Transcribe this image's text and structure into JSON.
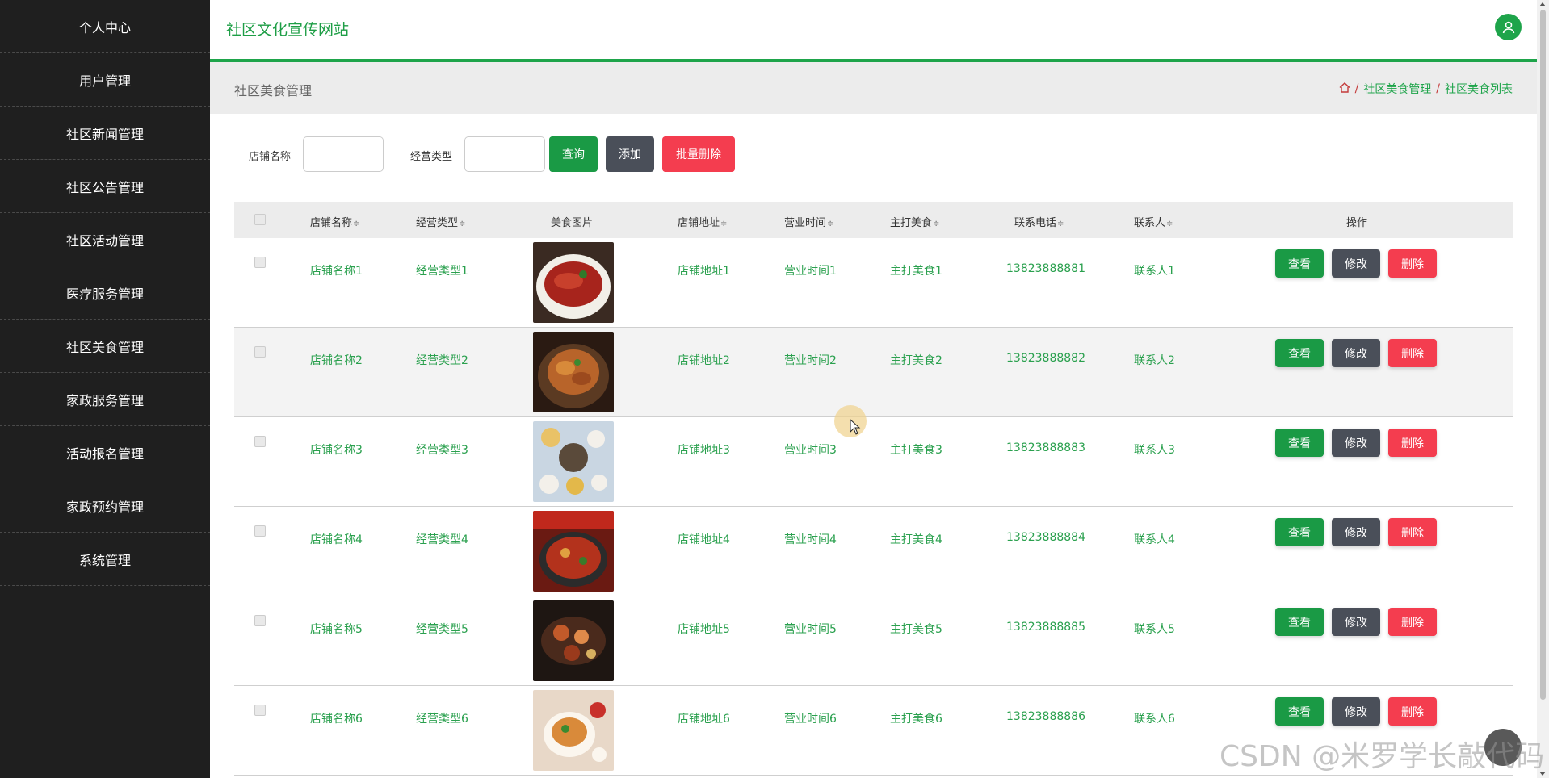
{
  "sidebar": {
    "items": [
      {
        "label": "个人中心"
      },
      {
        "label": "用户管理"
      },
      {
        "label": "社区新闻管理"
      },
      {
        "label": "社区公告管理"
      },
      {
        "label": "社区活动管理"
      },
      {
        "label": "医疗服务管理"
      },
      {
        "label": "社区美食管理"
      },
      {
        "label": "家政服务管理"
      },
      {
        "label": "活动报名管理"
      },
      {
        "label": "家政预约管理"
      },
      {
        "label": "系统管理"
      }
    ]
  },
  "header": {
    "title": "社区文化宣传网站",
    "avatar_icon": "user-icon"
  },
  "breadcrumb": {
    "page_title": "社区美食管理",
    "home_icon": "home-icon",
    "level1": "社区美食管理",
    "level2": "社区美食列表",
    "separator": "/"
  },
  "search": {
    "shop_name_label": "店铺名称",
    "shop_name_value": "",
    "business_type_label": "经营类型",
    "business_type_value": "",
    "query_label": "查询",
    "add_label": "添加",
    "batch_delete_label": "批量删除"
  },
  "table": {
    "columns": [
      "店铺名称",
      "经营类型",
      "美食图片",
      "店铺地址",
      "营业时间",
      "主打美食",
      "联系电话",
      "联系人",
      "操作"
    ],
    "sort_icon": "≑",
    "actions": {
      "view": "查看",
      "edit": "修改",
      "delete": "删除"
    },
    "rows": [
      {
        "shop": "店铺名称1",
        "type": "经营类型1",
        "address": "店铺地址1",
        "hours": "营业时间1",
        "signature": "主打美食1",
        "phone": "13823888881",
        "contact": "联系人1"
      },
      {
        "shop": "店铺名称2",
        "type": "经营类型2",
        "address": "店铺地址2",
        "hours": "营业时间2",
        "signature": "主打美食2",
        "phone": "13823888882",
        "contact": "联系人2"
      },
      {
        "shop": "店铺名称3",
        "type": "经营类型3",
        "address": "店铺地址3",
        "hours": "营业时间3",
        "signature": "主打美食3",
        "phone": "13823888883",
        "contact": "联系人3"
      },
      {
        "shop": "店铺名称4",
        "type": "经营类型4",
        "address": "店铺地址4",
        "hours": "营业时间4",
        "signature": "主打美食4",
        "phone": "13823888884",
        "contact": "联系人4"
      },
      {
        "shop": "店铺名称5",
        "type": "经营类型5",
        "address": "店铺地址5",
        "hours": "营业时间5",
        "signature": "主打美食5",
        "phone": "13823888885",
        "contact": "联系人5"
      },
      {
        "shop": "店铺名称6",
        "type": "经营类型6",
        "address": "店铺地址6",
        "hours": "营业时间6",
        "signature": "主打美食6",
        "phone": "13823888886",
        "contact": "联系人6"
      }
    ]
  },
  "watermark": "CSDN @米罗学长敲代码",
  "colors": {
    "accent": "#1ea44a",
    "sidebar_bg": "#1f1f1f",
    "danger": "#f43d4f",
    "neutral": "#4a4f59"
  }
}
